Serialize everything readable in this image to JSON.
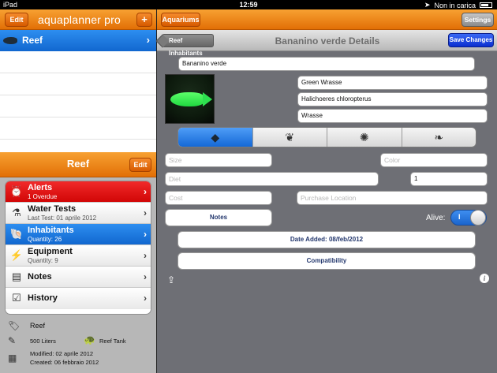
{
  "status_bar": {
    "device": "iPad",
    "time": "12:59",
    "carrier": "Non in carica"
  },
  "left_pane": {
    "edit_label": "Edit",
    "logo": "aquaplanner pro",
    "add_label": "+",
    "tank_name": "Reef",
    "section_title": "Reef",
    "section_edit_label": "Edit",
    "menu": [
      {
        "title": "Alerts",
        "subtitle": "1 Overdue",
        "icon": "alarm-clock-icon"
      },
      {
        "title": "Water Tests",
        "subtitle": "Last Test: 01 aprile 2012",
        "icon": "flask-icon"
      },
      {
        "title": "Inhabitants",
        "subtitle": "Quantity: 26",
        "icon": "shell-icon"
      },
      {
        "title": "Equipment",
        "subtitle": "Quantity: 9",
        "icon": "power-outlet-icon"
      },
      {
        "title": "Notes",
        "subtitle": "",
        "icon": "notebook-icon"
      },
      {
        "title": "History",
        "subtitle": "",
        "icon": "checklist-icon"
      }
    ],
    "info": {
      "name": "Reef",
      "volume": "500 Liters",
      "tank_type": "Reef Tank",
      "modified": "Modified: 02 aprile 2012",
      "created": "Created: 06 febbraio 2012"
    }
  },
  "right_pane": {
    "aquariums_label": "Aquariums",
    "settings_label": "Settings",
    "back_label": "Reef Inhabitants",
    "title": "Bananino verde Details",
    "save_label": "Save Changes",
    "nickname": "Bananino verde",
    "common_name": "Green Wrasse",
    "scientific_name": "Halichoeres chloropterus",
    "category": "Wrasse",
    "segments": [
      "fish-icon",
      "shell-icon",
      "coral-icon",
      "plant-icon"
    ],
    "size_placeholder": "Size",
    "color_placeholder": "Color",
    "diet_placeholder": "Diet",
    "quantity": "1",
    "cost_placeholder": "Cost",
    "purchase_location_placeholder": "Purchase Location",
    "notes_label": "Notes",
    "alive_label": "Alive:",
    "alive_toggle_text": "I",
    "date_added": "Date Added:  08/feb/2012",
    "compatibility_label": "Compatibility"
  }
}
